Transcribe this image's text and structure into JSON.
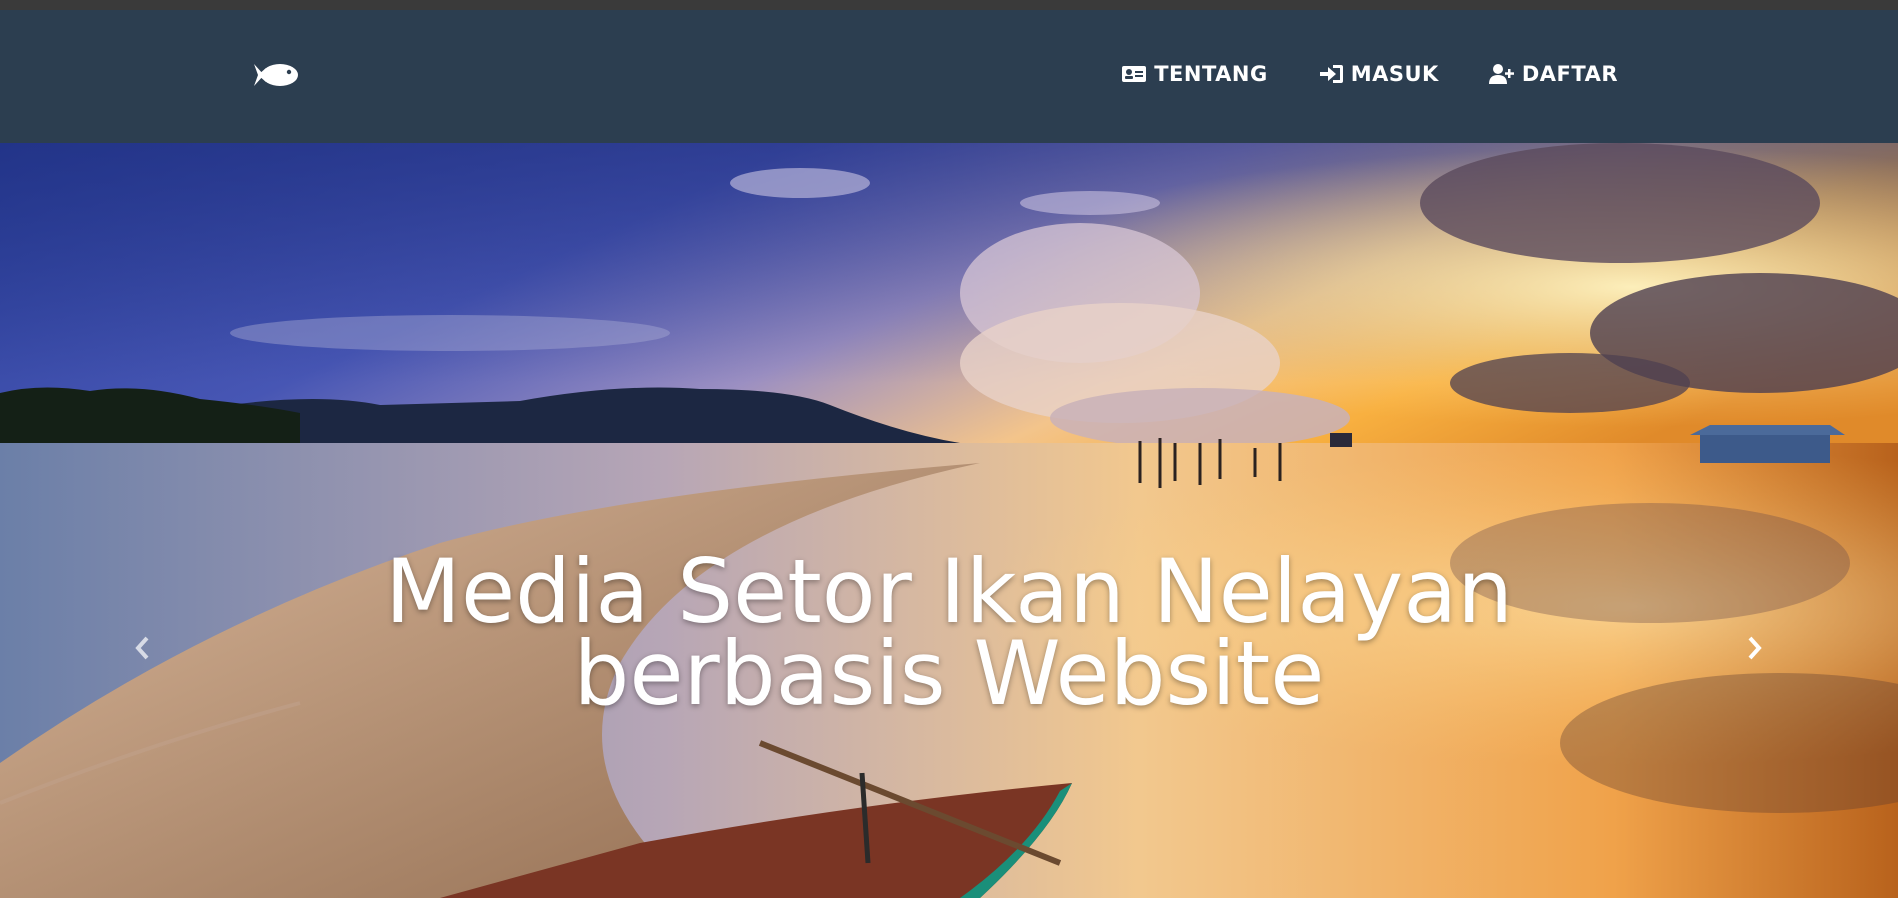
{
  "brand": {
    "icon": "fish-icon"
  },
  "nav": {
    "items": [
      {
        "icon": "id-card-icon",
        "label": "TENTANG"
      },
      {
        "icon": "sign-in-icon",
        "label": "MASUK"
      },
      {
        "icon": "user-plus-icon",
        "label": "DAFTAR"
      }
    ]
  },
  "hero": {
    "title_line1": "Media Setor Ikan Nelayan",
    "title_line2": "berbasis Website",
    "prev_icon": "chevron-left-icon",
    "next_icon": "chevron-right-icon"
  },
  "colors": {
    "navbar_bg": "#2c3e50",
    "nav_text": "#ffffff"
  }
}
